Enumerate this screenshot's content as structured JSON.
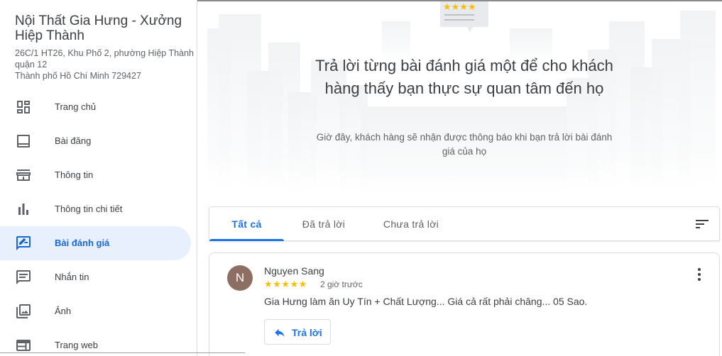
{
  "business": {
    "name": "Nội Thất Gia Hưng - Xưởng Hiệp Thành",
    "address_line1": "26C/1 HT26, Khu Phố 2, phường Hiệp Thành",
    "address_line2": "quận 12",
    "address_line3": "Thành phố Hồ Chí Minh 729427"
  },
  "sidebar": {
    "items": [
      {
        "label": "Trang chủ",
        "icon": "dashboard-icon"
      },
      {
        "label": "Bài đăng",
        "icon": "posts-icon"
      },
      {
        "label": "Thông tin",
        "icon": "storefront-icon"
      },
      {
        "label": "Thông tin chi tiết",
        "icon": "bar-chart-icon"
      },
      {
        "label": "Bài đánh giá",
        "icon": "rate-review-icon",
        "active": true
      },
      {
        "label": "Nhắn tin",
        "icon": "message-icon"
      },
      {
        "label": "Ảnh",
        "icon": "photo-icon"
      },
      {
        "label": "Trang web",
        "icon": "web-icon"
      }
    ]
  },
  "hero": {
    "title": "Trả lời từng bài đánh giá một để cho khách hàng thấy bạn thực sự quan tâm đến họ",
    "subtitle": "Giờ đây, khách hàng sẽ nhận được thông báo khi bạn trả lời bài đánh giá của họ",
    "badge_stars": "★★★★"
  },
  "tabs": [
    {
      "label": "Tất cả",
      "active": true
    },
    {
      "label": "Đã trả lời"
    },
    {
      "label": "Chưa trả lời"
    }
  ],
  "review": {
    "avatar_initial": "N",
    "avatar_color": "#8d6e63",
    "name": "Nguyen Sang",
    "stars": "★★★★★",
    "rating": 5,
    "time": "2 giờ trước",
    "text": "Gia Hưng làm ăn Uy Tín + Chất Lượng... Giá cả rất phải chăng... 05 Sao.",
    "reply_label": "Trả lời"
  },
  "colors": {
    "accent": "#1a73e8",
    "active_bg": "#e8f0fe",
    "star": "#fbbc04"
  }
}
